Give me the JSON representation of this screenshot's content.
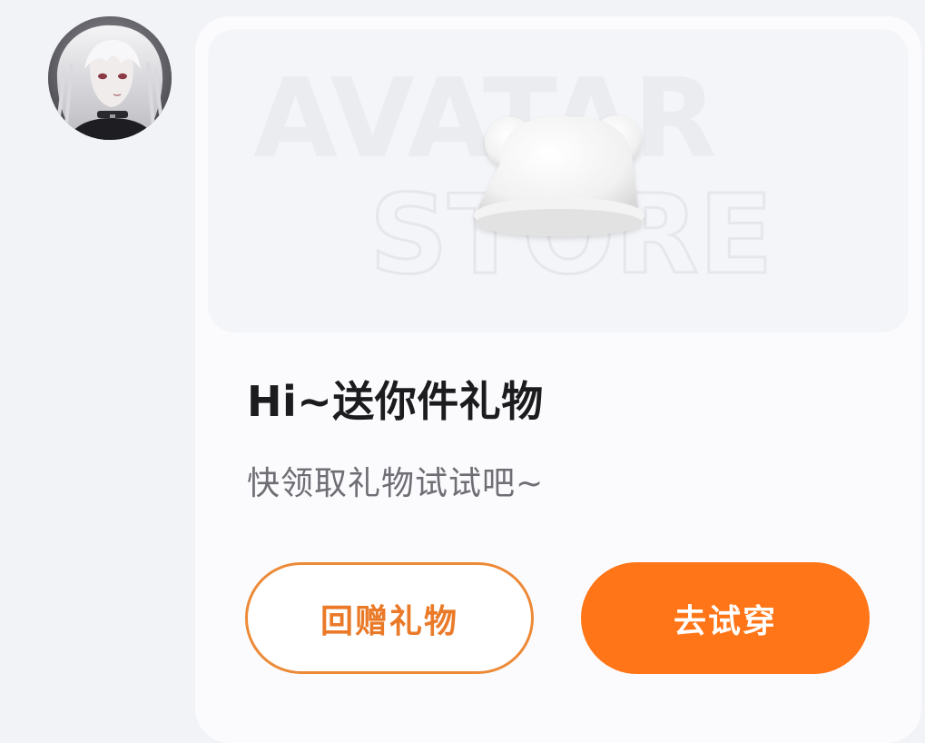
{
  "sender": {
    "avatar_desc": "avatar"
  },
  "gift_card": {
    "banner_watermark": {
      "line1": "AVATAR",
      "line2": "STORE"
    },
    "title": "Hi~送你件礼物",
    "subtitle": "快领取礼物试试吧~",
    "buttons": {
      "return_gift": "回赠礼物",
      "try_on": "去试穿"
    }
  },
  "colors": {
    "accent": "#ff7517",
    "outline_button_border": "#ec8a38",
    "outline_button_text": "#ea7a28",
    "title_text": "#1c1c1f",
    "subtitle_text": "#6e6e74",
    "page_background": "#f2f3f7",
    "card_background": "#fbfbfd"
  }
}
